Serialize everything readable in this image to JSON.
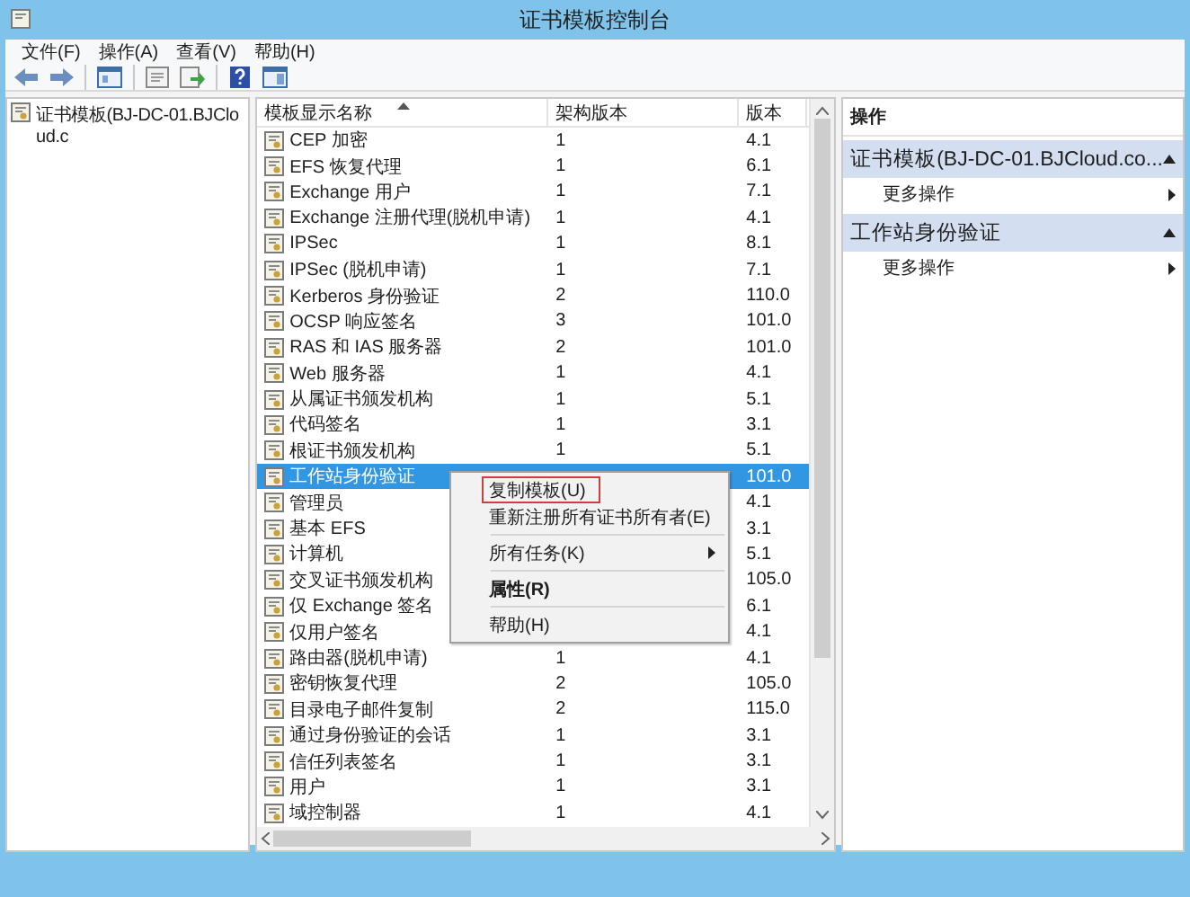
{
  "window": {
    "title": "证书模板控制台"
  },
  "menu_bar": [
    "文件(F)",
    "操作(A)",
    "查看(V)",
    "帮助(H)"
  ],
  "toolbar": [
    {
      "kind": "back"
    },
    {
      "kind": "forward"
    },
    {
      "kind": "separator"
    },
    {
      "kind": "tree"
    },
    {
      "kind": "separator"
    },
    {
      "kind": "properties"
    },
    {
      "kind": "export"
    },
    {
      "kind": "separator"
    },
    {
      "kind": "help"
    },
    {
      "kind": "pane"
    }
  ],
  "tree": {
    "items": [
      {
        "label": "证书模板(BJ-DC-01.BJCloud.c",
        "selected": false
      }
    ]
  },
  "table": {
    "columns": [
      {
        "label": "模板显示名称",
        "sorted": true
      },
      {
        "label": "架构版本",
        "sorted": false
      },
      {
        "label": "版本",
        "sorted": false
      }
    ],
    "rows": [
      {
        "name": "CEP 加密",
        "schema": "1",
        "version": "4.1",
        "selected": false
      },
      {
        "name": "EFS 恢复代理",
        "schema": "1",
        "version": "6.1",
        "selected": false
      },
      {
        "name": "Exchange 用户",
        "schema": "1",
        "version": "7.1",
        "selected": false
      },
      {
        "name": "Exchange 注册代理(脱机申请)",
        "schema": "1",
        "version": "4.1",
        "selected": false
      },
      {
        "name": "IPSec",
        "schema": "1",
        "version": "8.1",
        "selected": false
      },
      {
        "name": "IPSec (脱机申请)",
        "schema": "1",
        "version": "7.1",
        "selected": false
      },
      {
        "name": "Kerberos 身份验证",
        "schema": "2",
        "version": "110.0",
        "selected": false
      },
      {
        "name": "OCSP 响应签名",
        "schema": "3",
        "version": "101.0",
        "selected": false
      },
      {
        "name": "RAS 和 IAS 服务器",
        "schema": "2",
        "version": "101.0",
        "selected": false
      },
      {
        "name": "Web 服务器",
        "schema": "1",
        "version": "4.1",
        "selected": false
      },
      {
        "name": "从属证书颁发机构",
        "schema": "1",
        "version": "5.1",
        "selected": false
      },
      {
        "name": "代码签名",
        "schema": "1",
        "version": "3.1",
        "selected": false
      },
      {
        "name": "根证书颁发机构",
        "schema": "1",
        "version": "5.1",
        "selected": false
      },
      {
        "name": "工作站身份验证",
        "version": "101.0",
        "selected": true
      },
      {
        "name": "管理员",
        "version": "4.1",
        "selected": false
      },
      {
        "name": "基本 EFS",
        "version": "3.1",
        "selected": false
      },
      {
        "name": "计算机",
        "version": "5.1",
        "selected": false
      },
      {
        "name": "交叉证书颁发机构",
        "version": "105.0",
        "selected": false
      },
      {
        "name": "仅 Exchange 签名",
        "version": "6.1",
        "selected": false
      },
      {
        "name": "仅用户签名",
        "version": "4.1",
        "selected": false
      },
      {
        "name": "路由器(脱机申请)",
        "schema": "1",
        "version": "4.1",
        "selected": false
      },
      {
        "name": "密钥恢复代理",
        "schema": "2",
        "version": "105.0",
        "selected": false
      },
      {
        "name": "目录电子邮件复制",
        "schema": "2",
        "version": "115.0",
        "selected": false
      },
      {
        "name": "通过身份验证的会话",
        "schema": "1",
        "version": "3.1",
        "selected": false
      },
      {
        "name": "信任列表签名",
        "schema": "1",
        "version": "3.1",
        "selected": false
      },
      {
        "name": "用户",
        "schema": "1",
        "version": "3.1",
        "selected": false
      },
      {
        "name": "域控制器",
        "schema": "1",
        "version": "4.1",
        "selected": false
      }
    ]
  },
  "context_menu": {
    "items": [
      {
        "kind": "item",
        "label": "复制模板(U)",
        "outlined": true,
        "default": false
      },
      {
        "kind": "item",
        "label": "重新注册所有证书所有者(E)",
        "outlined": false,
        "default": false
      },
      {
        "kind": "separator"
      },
      {
        "kind": "submenu",
        "label": "所有任务(K)",
        "outlined": false,
        "default": false
      },
      {
        "kind": "separator"
      },
      {
        "kind": "item",
        "label": "属性(R)",
        "outlined": false,
        "default": true
      },
      {
        "kind": "separator"
      },
      {
        "kind": "item",
        "label": "帮助(H)",
        "outlined": false,
        "default": false
      }
    ]
  },
  "actions": {
    "title": "操作",
    "sections": [
      {
        "title": "证书模板(BJ-DC-01.BJCloud.co...",
        "expanded": true,
        "items": [
          {
            "label": "更多操作",
            "submenu": true
          }
        ]
      },
      {
        "title": "工作站身份验证",
        "expanded": true,
        "items": [
          {
            "label": "更多操作",
            "submenu": true
          }
        ]
      }
    ]
  }
}
